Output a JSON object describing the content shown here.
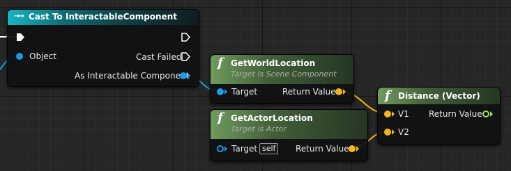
{
  "colors": {
    "object_pin": "#1e9be6",
    "vector_pin": "#f3b61b",
    "float_pin": "#9be05a",
    "exec_pin": "#ffffff",
    "cast_header": "#17b6c4",
    "function_header": "#6f9b5e"
  },
  "nodes": {
    "cast": {
      "icon": "cast-arrows-icon",
      "title": "Cast To InteractableComponent",
      "object_label": "Object",
      "cast_failed_label": "Cast Failed",
      "as_label": "As Interactable Component"
    },
    "get_world_location": {
      "icon": "function-icon",
      "title": "GetWorldLocation",
      "subtitle": "Target is Scene Component",
      "target_label": "Target",
      "return_label": "Return Value"
    },
    "get_actor_location": {
      "icon": "function-icon",
      "title": "GetActorLocation",
      "subtitle": "Target is Actor",
      "target_label": "Target",
      "self_label": "self",
      "return_label": "Return Value"
    },
    "distance": {
      "icon": "function-icon",
      "title": "Distance (Vector)",
      "v1_label": "V1",
      "v2_label": "V2",
      "return_label": "Return Value"
    }
  }
}
